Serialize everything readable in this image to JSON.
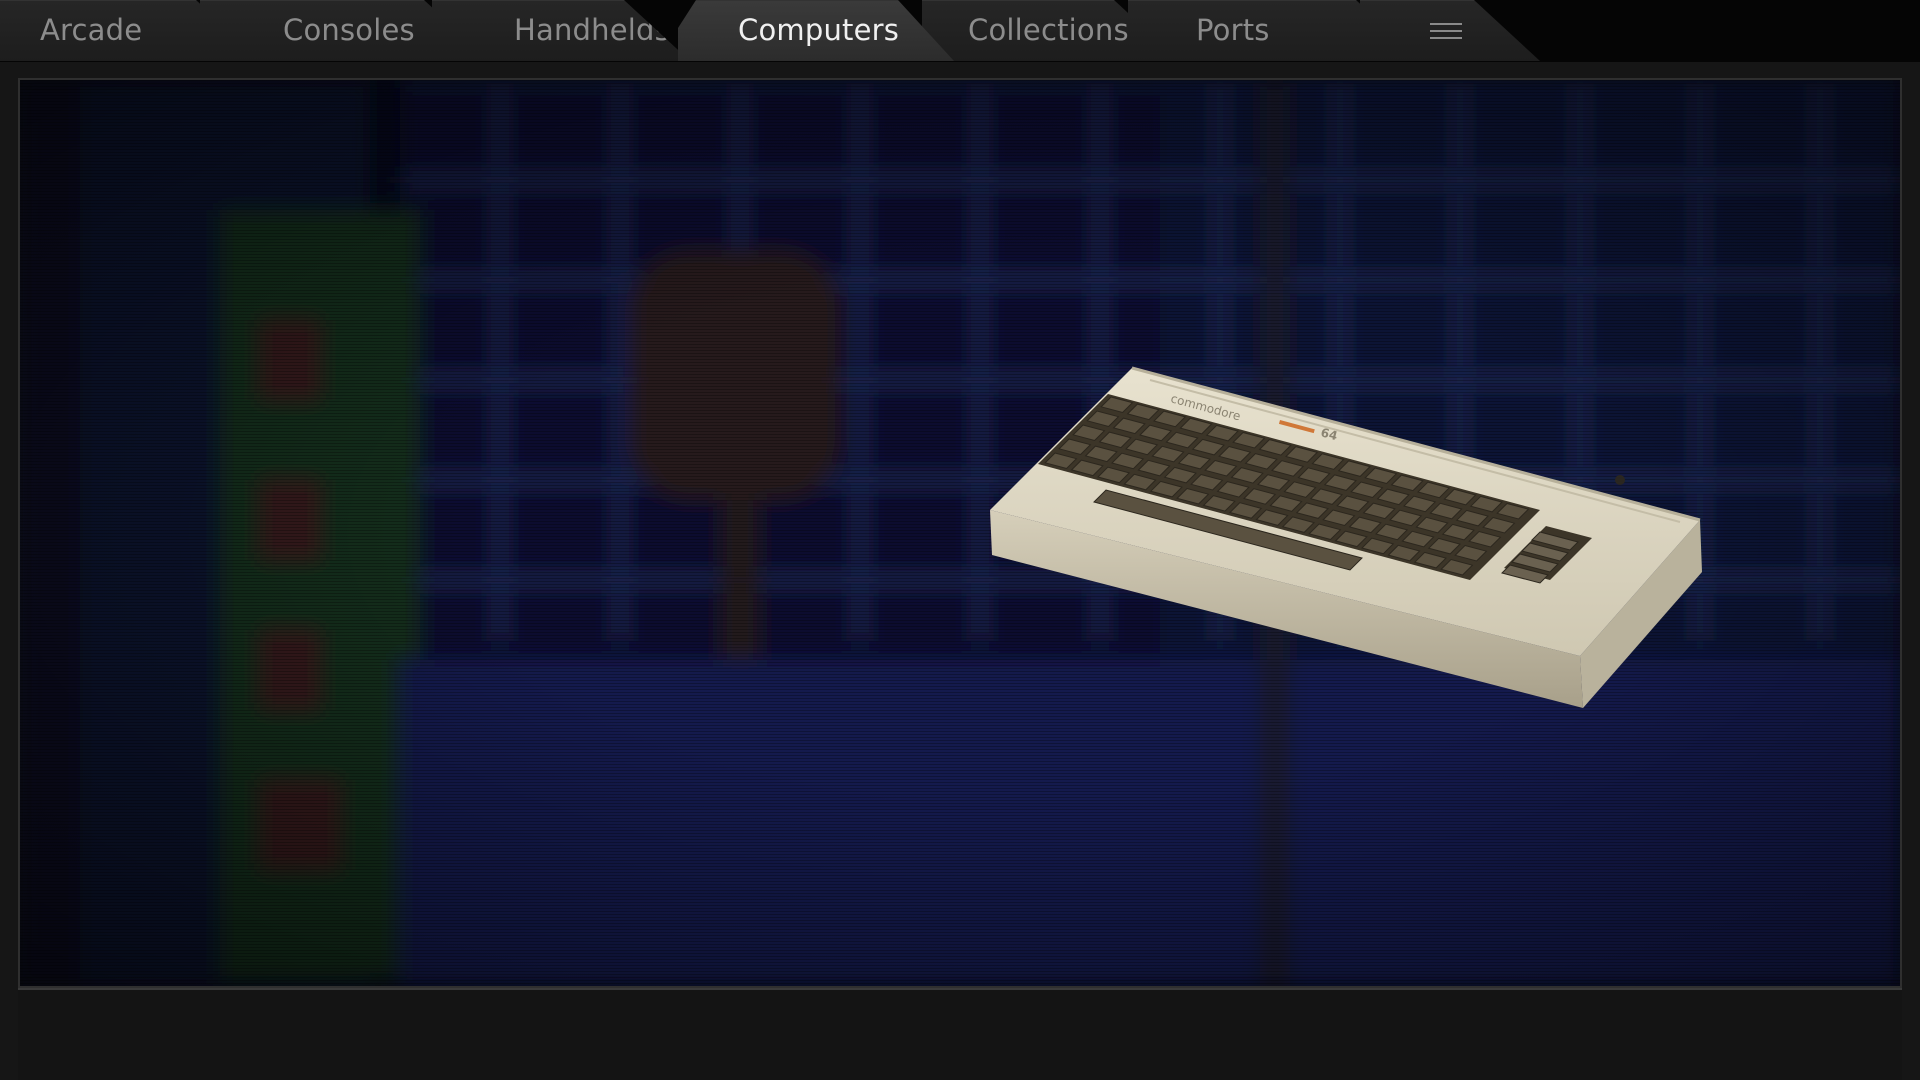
{
  "tabs": [
    {
      "label": "Arcade",
      "active": false
    },
    {
      "label": "Consoles",
      "active": false
    },
    {
      "label": "Handhelds",
      "active": false
    },
    {
      "label": "Computers",
      "active": true
    },
    {
      "label": "Collections",
      "active": false
    },
    {
      "label": "Ports",
      "active": false
    }
  ],
  "menu_icon": "hamburger-menu-icon",
  "selected_system": {
    "image": "commodore-64-computer",
    "brand_label": "commodore",
    "model_label": "64"
  },
  "colors": {
    "tab_active_text": "#f0f0f0",
    "tab_inactive_text": "#8c8c8c",
    "panel_background": "#070a1c",
    "computer_case": "#ddd6c2",
    "keys": "#4b4335"
  }
}
